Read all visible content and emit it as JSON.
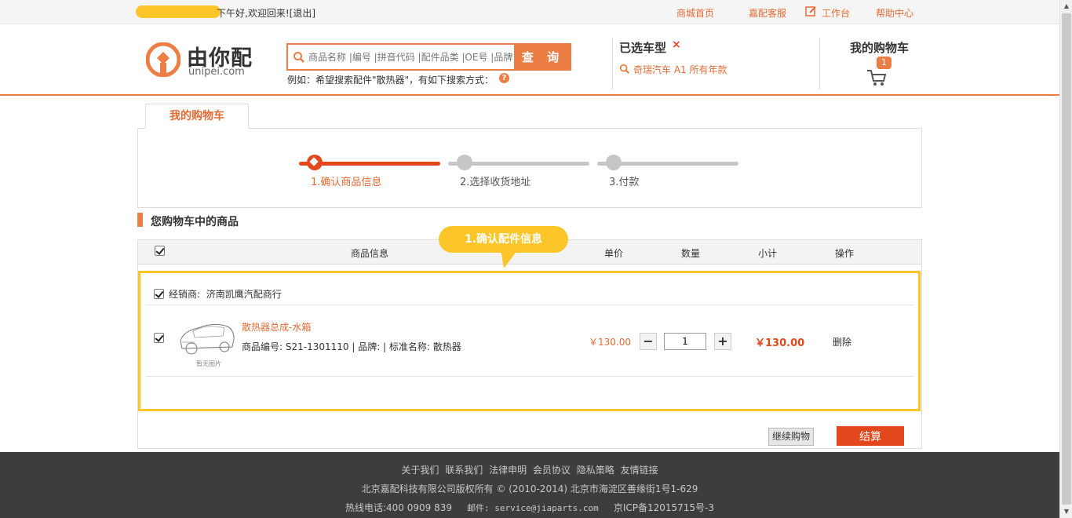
{
  "topbar": {
    "greeting": "下午好,欢迎回来!",
    "logout": "[退出]",
    "links": {
      "home": "商城首页",
      "service": "嘉配客服",
      "workbench": "工作台",
      "help": "帮助中心"
    }
  },
  "header": {
    "brand": "由你配",
    "domain": "unipei.com",
    "search_placeholder": "商品名称 |编号 |拼音代码 |配件品类 |OE号 |品牌",
    "search_button": "查 询",
    "example": "例如：希望搜索配件\"散热器\"，有如下搜索方式：",
    "help_mark": "?",
    "selected_car_title": "已选车型",
    "selected_car_clear": "×",
    "selected_car_value": "奇瑞汽车 A1 所有年款",
    "cart_title": "我的购物车",
    "cart_count": "1"
  },
  "tab": {
    "label": "我的购物车"
  },
  "steps": [
    {
      "label": "1.确认商品信息",
      "active": true
    },
    {
      "label": "2.选择收货地址",
      "active": false
    },
    {
      "label": "3.付款",
      "active": false
    }
  ],
  "section_title": "您购物车中的商品",
  "table": {
    "columns": {
      "info": "商品信息",
      "price": "单价",
      "qty": "数量",
      "subtotal": "小计",
      "action": "操作"
    }
  },
  "callout": "1.确认配件信息",
  "dealer": {
    "label": "经销商:",
    "name": "济南凯鹰汽配商行"
  },
  "item": {
    "image_caption": "暂无图片",
    "name": "散热器总成-水箱",
    "meta": "商品编号: S21-1301110 | 品牌:  | 标准名称: 散热器",
    "price": "￥130.00",
    "qty_minus": "−",
    "qty_value": "1",
    "qty_plus": "+",
    "subtotal": "￥130.00",
    "delete": "删除"
  },
  "buttons": {
    "continue": "继续购物",
    "checkout": "结算"
  },
  "footer": {
    "links": [
      "关于我们",
      "联系我们",
      "法律申明",
      "会员协议",
      "隐私策略",
      "友情链接"
    ],
    "copyright": "北京嘉配科技有限公司版权所有 © (2010-2014) 北京市海淀区善缘街1号1-629",
    "hotline": "热线电话:400 0909 839",
    "email": "邮件: service@jiaparts.com",
    "icp": "京ICP备12015715号-3"
  },
  "colors": {
    "accent": "#ec7d45",
    "highlight": "#fcc62b",
    "price": "#e3471c"
  }
}
